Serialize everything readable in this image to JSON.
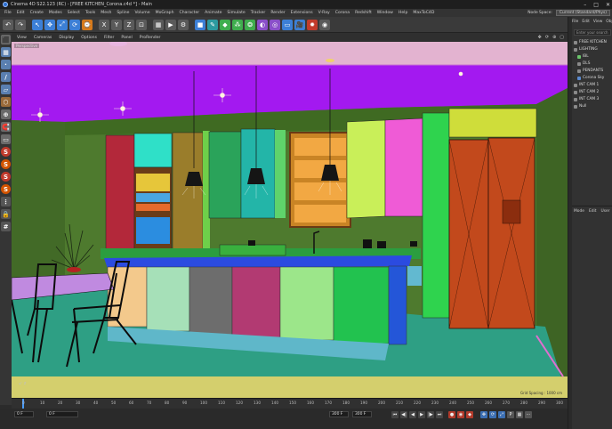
{
  "window": {
    "title": "Cinema 4D S22.123 (RC) - [FREE KITCHEN_Corona.c4d *] - Main",
    "controls": {
      "minimize": "–",
      "maximize": "□",
      "close": "✕"
    }
  },
  "menubar": {
    "items": [
      "File",
      "Edit",
      "Create",
      "Modes",
      "Select",
      "Tools",
      "Mesh",
      "Spline",
      "Volume",
      "MoGraph",
      "Character",
      "Animate",
      "Simulate",
      "Tracker",
      "Render",
      "Extensions",
      "V-Ray",
      "Corona",
      "Redshift",
      "Window",
      "Help",
      "MaxToC4D"
    ],
    "node_space_label": "Node Space:",
    "layout_value": "Current (Standard/Phys)"
  },
  "toolbar": {
    "icons": [
      "undo-icon",
      "redo-icon",
      "select-icon",
      "move-icon",
      "scale-icon",
      "rotate-icon",
      "recent-icon",
      "x-axis-icon",
      "y-axis-icon",
      "z-axis-icon",
      "coord-icon",
      "render-view-icon",
      "render-icon",
      "render-settings-icon",
      "cube-icon",
      "pen-icon",
      "subdivide-icon",
      "array-icon",
      "cloner-icon",
      "deformer-icon",
      "field-icon",
      "floor-icon",
      "camera-icon",
      "light-icon",
      "tag-icon"
    ],
    "axis_labels": {
      "x": "X",
      "y": "Y",
      "z": "Z"
    },
    "colors": {
      "blue": "#3c7fd6",
      "orange": "#d67a1c",
      "green": "#3fae4e",
      "red": "#c23b2b",
      "purple": "#8a4fc9",
      "teal": "#2c9aa0",
      "grey": "#5a5a5a"
    }
  },
  "left_tools": {
    "icons": [
      "model-mode-icon",
      "mesh-mode-icon",
      "points-mode-icon",
      "edges-mode-icon",
      "polygons-mode-icon",
      "uvw-mode-icon",
      "axis-mode-icon",
      "snap-icon",
      "workplane-icon",
      "s-tool-a",
      "s-tool-b",
      "s-tool-c",
      "s-tool-d",
      "dots-icon",
      "lock-icon",
      "grid-icon"
    ],
    "s_label": "S"
  },
  "viewport": {
    "menu": [
      "View",
      "Cameras",
      "Display",
      "Options",
      "Filter",
      "Panel",
      "ProRender"
    ],
    "camera_label": "Perspective",
    "stats": "Grid Spacing : 1000 cm",
    "colors": {
      "ceiling": "#a319f0",
      "ceiling_top": "#e3b3d0",
      "back_wall": "#4e7a2e",
      "floor": "#2e9f84",
      "floor_front": "#d4cf6d",
      "island_top": "#2b4be0",
      "pendant": "#151515"
    }
  },
  "timeline": {
    "ticks": [
      "0",
      "10",
      "20",
      "30",
      "40",
      "50",
      "60",
      "70",
      "80",
      "90",
      "100",
      "110",
      "120",
      "130",
      "140",
      "150",
      "160",
      "170",
      "180",
      "190",
      "200",
      "210",
      "220",
      "230",
      "240",
      "250",
      "260",
      "270",
      "280",
      "290",
      "300"
    ],
    "end_label": "0 F"
  },
  "transport": {
    "current_frame": "0 F",
    "start_frame": "0 F",
    "end_frame": "300 F",
    "max_frame": "300 F",
    "buttons": [
      "go-start-icon",
      "prev-key-icon",
      "play-back-icon",
      "play-icon",
      "next-key-icon",
      "go-end-icon"
    ],
    "record_buttons": [
      "record-icon",
      "auto-key-icon",
      "key-icon"
    ],
    "extra_buttons": [
      "move-key-icon",
      "rotate-key-icon",
      "scale-key-icon",
      "param-key-icon",
      "pla-key-icon",
      "dope-icon"
    ]
  },
  "objects": {
    "menu": [
      "File",
      "Edit",
      "View",
      "Obj"
    ],
    "search_placeholder": "Enter your search",
    "items": [
      {
        "label": "FREE KITCHEN",
        "color": "grey",
        "indent": 0
      },
      {
        "label": "LIGHTING",
        "color": "grey",
        "indent": 0
      },
      {
        "label": "IBL",
        "color": "green",
        "indent": 1
      },
      {
        "label": "DLS",
        "color": "grey",
        "indent": 1
      },
      {
        "label": "PENDANTS",
        "color": "grey",
        "indent": 1
      },
      {
        "label": "Corona Sky",
        "color": "blue",
        "indent": 1
      },
      {
        "label": "INT CAM 1",
        "color": "grey",
        "indent": 0
      },
      {
        "label": "INT CAM 2",
        "color": "grey",
        "indent": 0
      },
      {
        "label": "INT CAM 3",
        "color": "grey",
        "indent": 0
      },
      {
        "label": "Null",
        "color": "grey",
        "indent": 0
      }
    ],
    "attributes_menu": [
      "Mode",
      "Edit",
      "User"
    ]
  }
}
